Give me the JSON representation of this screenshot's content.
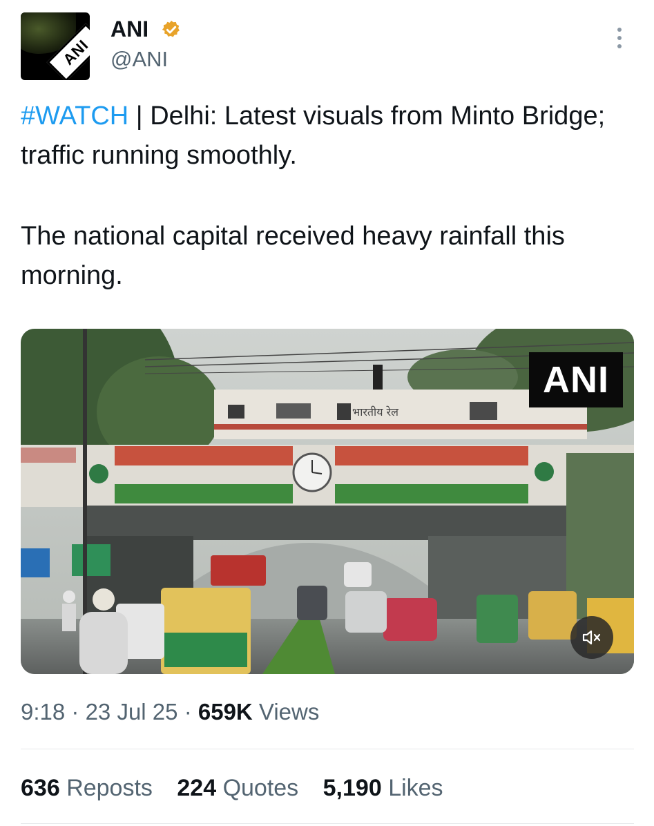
{
  "author": {
    "name": "ANI",
    "handle": "@ANI",
    "avatar_text": "ANI",
    "verified": true,
    "verified_color": "#e8a32a"
  },
  "tweet": {
    "hashtag": "#WATCH",
    "line1_rest": " | Delhi: Latest visuals from Minto Bridge; traffic running smoothly.",
    "line2": "The national capital received heavy rainfall this morning."
  },
  "media": {
    "watermark": "ANI",
    "train_text": "भारतीय रेल",
    "mute_icon": "speaker-muted-icon"
  },
  "meta": {
    "time": "9:18",
    "date": "23 Jul 25",
    "views_count": "659K",
    "views_label": "Views",
    "separator": "·"
  },
  "stats": {
    "reposts_count": "636",
    "reposts_label": "Reposts",
    "quotes_count": "224",
    "quotes_label": "Quotes",
    "likes_count": "5,190",
    "likes_label": "Likes"
  },
  "colors": {
    "link": "#1d9bf0",
    "secondary_text": "#536471"
  }
}
